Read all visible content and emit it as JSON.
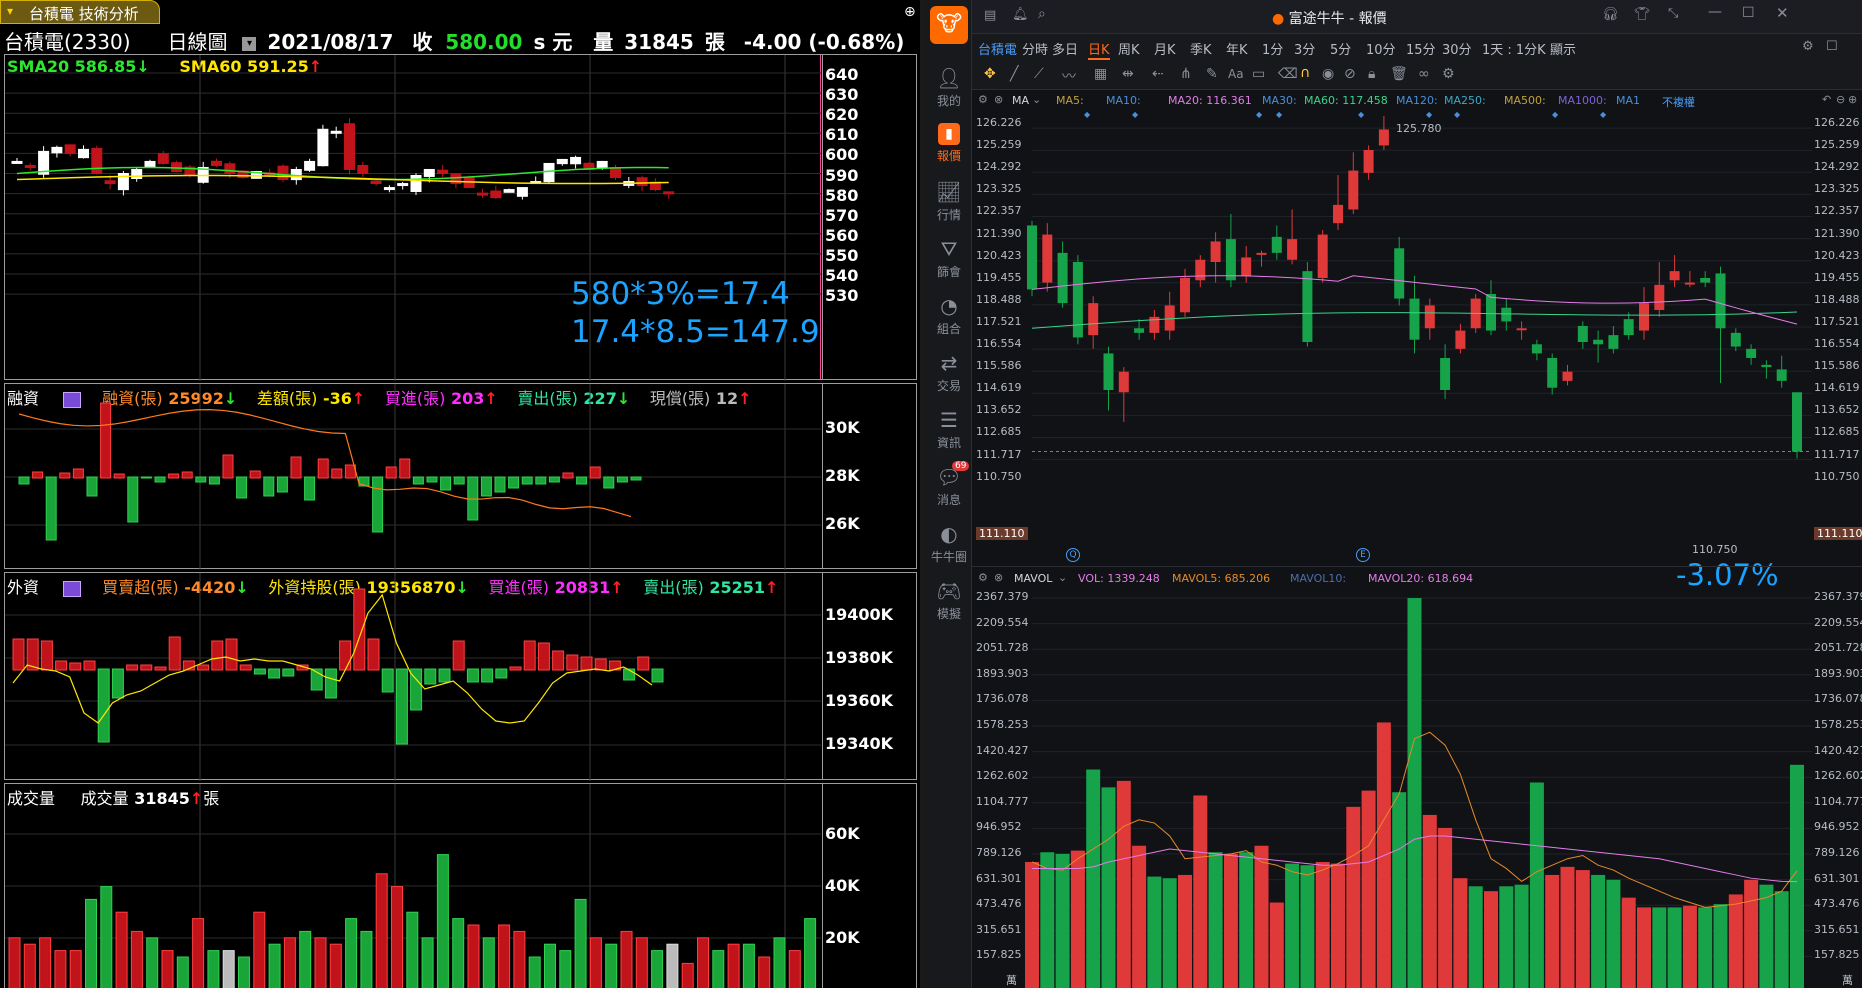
{
  "left": {
    "tab_label": "台積電 技術分析",
    "header": {
      "stock": "台積電(2330)",
      "chart_type": "日線圖",
      "date": "2021/08/17",
      "close_label": "收",
      "close_value": "580.00",
      "unit_s": "s 元",
      "volume_label": "量",
      "volume_value": "31845",
      "volume_unit": "張",
      "change": "-4.00 (-0.68%)"
    },
    "price_panel": {
      "sma20": "SMA20 586.85",
      "sma60": "SMA60 591.25",
      "annotation_1": "580*3%=17.4",
      "annotation_2": "17.4*8.5=147.9",
      "axis": [
        "640",
        "630",
        "620",
        "610",
        "600",
        "590",
        "580",
        "570",
        "560",
        "550",
        "540",
        "530"
      ]
    },
    "margin_panel": {
      "title": "融資",
      "i1_label": "融資(張)",
      "i1_value": "25992",
      "i2_label": "差額(張)",
      "i2_value": "-36",
      "i3_label": "買進(張)",
      "i3_value": "203",
      "i4_label": "賣出(張)",
      "i4_value": "227",
      "i5_label": "現償(張)",
      "i5_value": "12",
      "axis": [
        "30K",
        "28K",
        "26K"
      ]
    },
    "foreign_panel": {
      "title": "外資",
      "i1_label": "買賣超(張)",
      "i1_value": "-4420",
      "i2_label": "外資持股(張)",
      "i2_value": "19356870",
      "i3_label": "買進(張)",
      "i3_value": "20831",
      "i4_label": "賣出(張)",
      "i4_value": "25251",
      "axis": [
        "19400K",
        "19380K",
        "19360K",
        "19340K"
      ]
    },
    "volume_panel": {
      "title": "成交量",
      "i1_label": "成交量",
      "i1_value": "31845",
      "i1_unit": "張",
      "axis": [
        "60K",
        "40K",
        "20K"
      ]
    }
  },
  "right": {
    "window_title": "富途牛牛 - 報價",
    "sidebar": [
      {
        "label": "我的",
        "icon": "person-icon"
      },
      {
        "label": "報價",
        "icon": "chart-bar-icon"
      },
      {
        "label": "行情",
        "icon": "trend-icon"
      },
      {
        "label": "篩會",
        "icon": "filter-icon"
      },
      {
        "label": "組合",
        "icon": "pie-icon"
      },
      {
        "label": "交易",
        "icon": "trade-icon"
      },
      {
        "label": "資訊",
        "icon": "news-icon"
      },
      {
        "label": "消息",
        "icon": "message-icon",
        "badge": "69"
      },
      {
        "label": "牛牛圈",
        "icon": "community-icon"
      },
      {
        "label": "模擬",
        "icon": "gamepad-icon"
      }
    ],
    "tabs": [
      "台積電",
      "分時",
      "多日",
      "日K",
      "周K",
      "月K",
      "季K",
      "年K",
      "1分",
      "3分",
      "5分",
      "10分",
      "15分",
      "30分",
      "1天 : 1分K",
      "顯示"
    ],
    "active_tab": "日K",
    "ma_bar": {
      "ma": "MA",
      "ma5": "MA5:",
      "ma10": "MA10:",
      "ma20": "MA20: 116.361",
      "ma30": "MA30:",
      "ma60": "MA60: 117.458",
      "ma120": "MA120:",
      "ma250": "MA250:",
      "ma500": "MA500:",
      "ma1000": "MA1000:",
      "ma1": "MA1",
      "adjust": "不複權"
    },
    "price_axis": [
      "126.226",
      "125.259",
      "124.292",
      "123.325",
      "122.357",
      "121.390",
      "120.423",
      "119.455",
      "118.488",
      "117.521",
      "116.554",
      "115.586",
      "114.619",
      "113.652",
      "112.685",
      "111.717",
      "110.750"
    ],
    "current_price": "111.110",
    "high_label": "125.780",
    "low_label": "110.750",
    "change_pct": "-3.07%",
    "vol_bar": {
      "mavol": "MAVOL",
      "vol": "VOL: 1339.248",
      "mavol5": "MAVOL5: 685.206",
      "mavol10": "MAVOL10:",
      "mavol20": "MAVOL20: 618.694"
    },
    "vol_axis": [
      "2367.379",
      "2209.554",
      "2051.728",
      "1893.903",
      "1736.078",
      "1578.253",
      "1420.427",
      "1262.602",
      "1104.777",
      "946.952",
      "789.126",
      "631.301",
      "473.476",
      "315.651",
      "157.825"
    ],
    "vol_unit": "萬"
  },
  "colors": {
    "up": "#c0131a",
    "down": "#1aa539",
    "right_up": "#e0393a",
    "right_down": "#16a34a"
  }
}
